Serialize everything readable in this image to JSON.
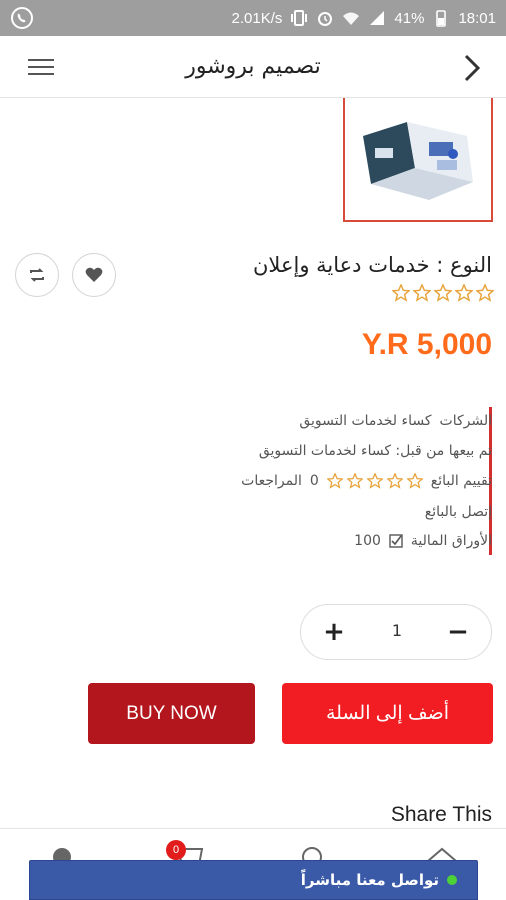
{
  "status_bar": {
    "net_speed": "2.01K/s",
    "battery": "41%",
    "time": "18:01"
  },
  "app_bar": {
    "title": "تصميم بروشور"
  },
  "product": {
    "type_label": "النوع : خدمات دعاية وإعلان",
    "rating_stars": 5,
    "price": "Y.R 5,000"
  },
  "seller": {
    "company_label": "الشركات",
    "company_name": "كساء لخدمات التسويق",
    "sold_by": "تم بيعها من قبل: كساء لخدمات التسويق",
    "seller_rating_label": "تقييم البائع",
    "reviews_count": "0",
    "reviews_label": "المراجعات",
    "contact_label": "إتصل بالبائع",
    "stock_label": "الأوراق المالية",
    "stock_value": "100"
  },
  "quantity": {
    "plus": "+",
    "value": "1",
    "minus": "−"
  },
  "buttons": {
    "buy_now": "BUY NOW",
    "add_to_cart": "أضف إلى السلة"
  },
  "share": {
    "title": "Share This"
  },
  "bottom_nav": {
    "cart_badge": "0"
  },
  "chat": {
    "label": "تواصل معنا مباشراً"
  },
  "colors": {
    "accent_orange": "#ff6b1a",
    "buy_now": "#b3161d",
    "add_to_cart": "#f11d23",
    "chat_bar": "#3a5aa8"
  }
}
